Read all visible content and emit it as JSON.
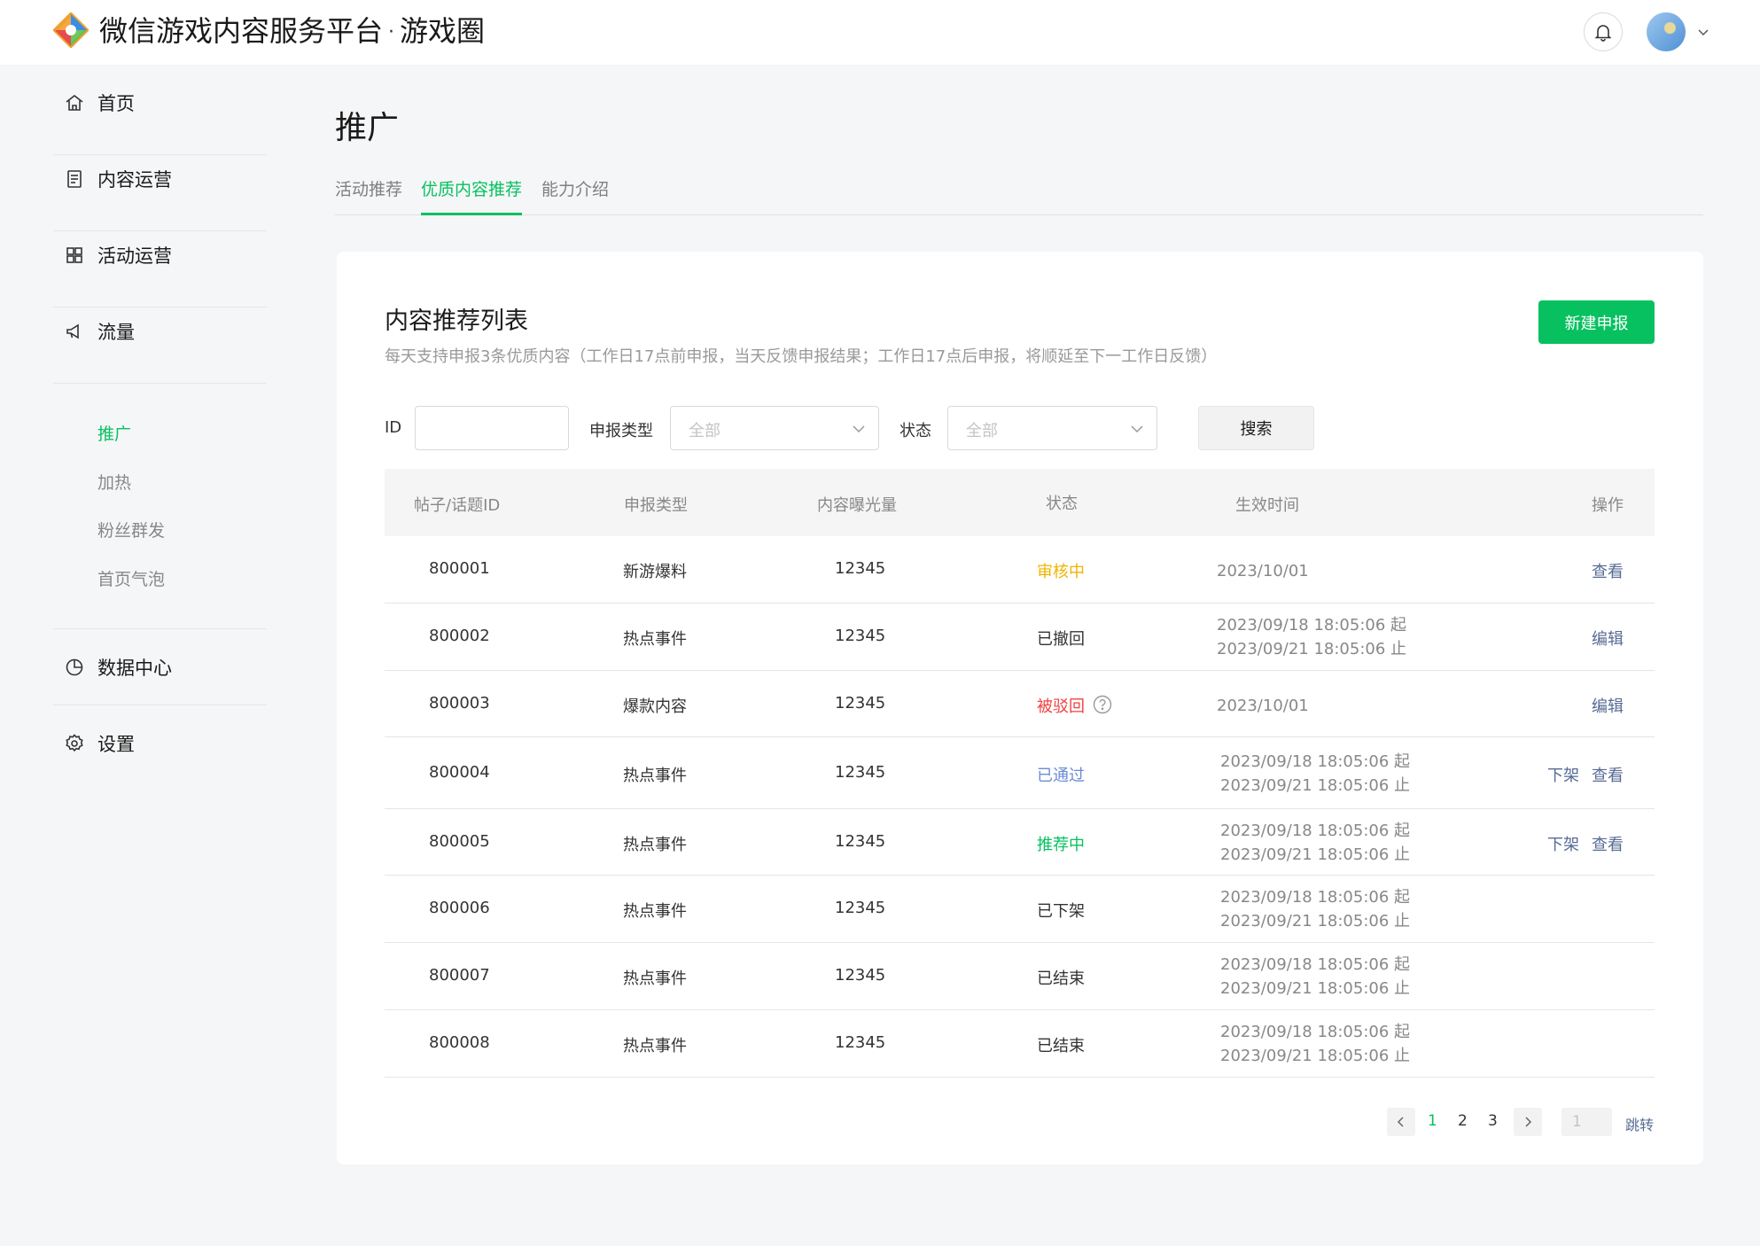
{
  "header": {
    "title": "微信游戏内容服务平台",
    "separator": "·",
    "subtitle": "游戏圈"
  },
  "sidebar": {
    "items": [
      {
        "label": "首页",
        "icon": "home-icon"
      },
      {
        "label": "内容运营",
        "icon": "document-icon"
      },
      {
        "label": "活动运营",
        "icon": "grid-icon"
      },
      {
        "label": "流量",
        "icon": "megaphone-icon"
      }
    ],
    "sub_items": [
      {
        "label": "推广",
        "active": true
      },
      {
        "label": "加热",
        "active": false
      },
      {
        "label": "粉丝群发",
        "active": false
      },
      {
        "label": "首页气泡",
        "active": false
      }
    ],
    "bottom_items": [
      {
        "label": "数据中心",
        "icon": "pie-chart-icon"
      },
      {
        "label": "设置",
        "icon": "gear-icon"
      }
    ]
  },
  "page": {
    "title": "推广",
    "tabs": [
      {
        "label": "活动推荐",
        "active": false
      },
      {
        "label": "优质内容推荐",
        "active": true
      },
      {
        "label": "能力介绍",
        "active": false
      }
    ]
  },
  "card": {
    "title": "内容推荐列表",
    "description": "每天支持申报3条优质内容（工作日17点前申报，当天反馈申报结果；工作日17点后申报，将顺延至下一工作日反馈）",
    "new_button": "新建申报"
  },
  "filters": {
    "id_label": "ID",
    "id_value": "",
    "type_label": "申报类型",
    "type_value": "全部",
    "status_label": "状态",
    "status_value": "全部",
    "search_button": "搜索"
  },
  "table": {
    "headers": [
      "帖子/话题ID",
      "申报类型",
      "内容曝光量",
      "状态",
      "生效时间",
      "操作"
    ],
    "rows": [
      {
        "id": "800001",
        "type": "新游爆料",
        "views": "12345",
        "status": "审核中",
        "status_class": "status-review",
        "time1": "2023/10/01",
        "time2": "",
        "actions": [
          "查看"
        ]
      },
      {
        "id": "800002",
        "type": "热点事件",
        "views": "12345",
        "status": "已撤回",
        "status_class": "",
        "time1": "2023/09/18 18:05:06 起",
        "time2": "2023/09/21 18:05:06 止",
        "actions": [
          "编辑"
        ]
      },
      {
        "id": "800003",
        "type": "爆款内容",
        "views": "12345",
        "status": "被驳回",
        "status_class": "status-rejected",
        "time1": "2023/10/01",
        "time2": "",
        "actions": [
          "编辑"
        ],
        "help": true
      },
      {
        "id": "800004",
        "type": "热点事件",
        "views": "12345",
        "status": "已通过",
        "status_class": "status-passed",
        "time1": "2023/09/18 18:05:06 起",
        "time2": "2023/09/21 18:05:06 止",
        "actions": [
          "下架",
          "查看"
        ]
      },
      {
        "id": "800005",
        "type": "热点事件",
        "views": "12345",
        "status": "推荐中",
        "status_class": "status-promo",
        "time1": "2023/09/18 18:05:06 起",
        "time2": "2023/09/21 18:05:06 止",
        "actions": [
          "下架",
          "查看"
        ]
      },
      {
        "id": "800006",
        "type": "热点事件",
        "views": "12345",
        "status": "已下架",
        "status_class": "",
        "time1": "2023/09/18 18:05:06 起",
        "time2": "2023/09/21 18:05:06 止",
        "actions": []
      },
      {
        "id": "800007",
        "type": "热点事件",
        "views": "12345",
        "status": "已结束",
        "status_class": "",
        "time1": "2023/09/18 18:05:06 起",
        "time2": "2023/09/21 18:05:06 止",
        "actions": []
      },
      {
        "id": "800008",
        "type": "热点事件",
        "views": "12345",
        "status": "已结束",
        "status_class": "",
        "time1": "2023/09/18 18:05:06 起",
        "time2": "2023/09/21 18:05:06 止",
        "actions": []
      }
    ]
  },
  "pagination": {
    "pages": [
      "1",
      "2",
      "3"
    ],
    "current": "1",
    "jump_value": "1",
    "jump_label": "跳转"
  },
  "colors": {
    "primary": "#07c160",
    "link": "#576b95",
    "review": "#f0b400",
    "rejected": "#f04141",
    "passed": "#6b8cd6"
  }
}
